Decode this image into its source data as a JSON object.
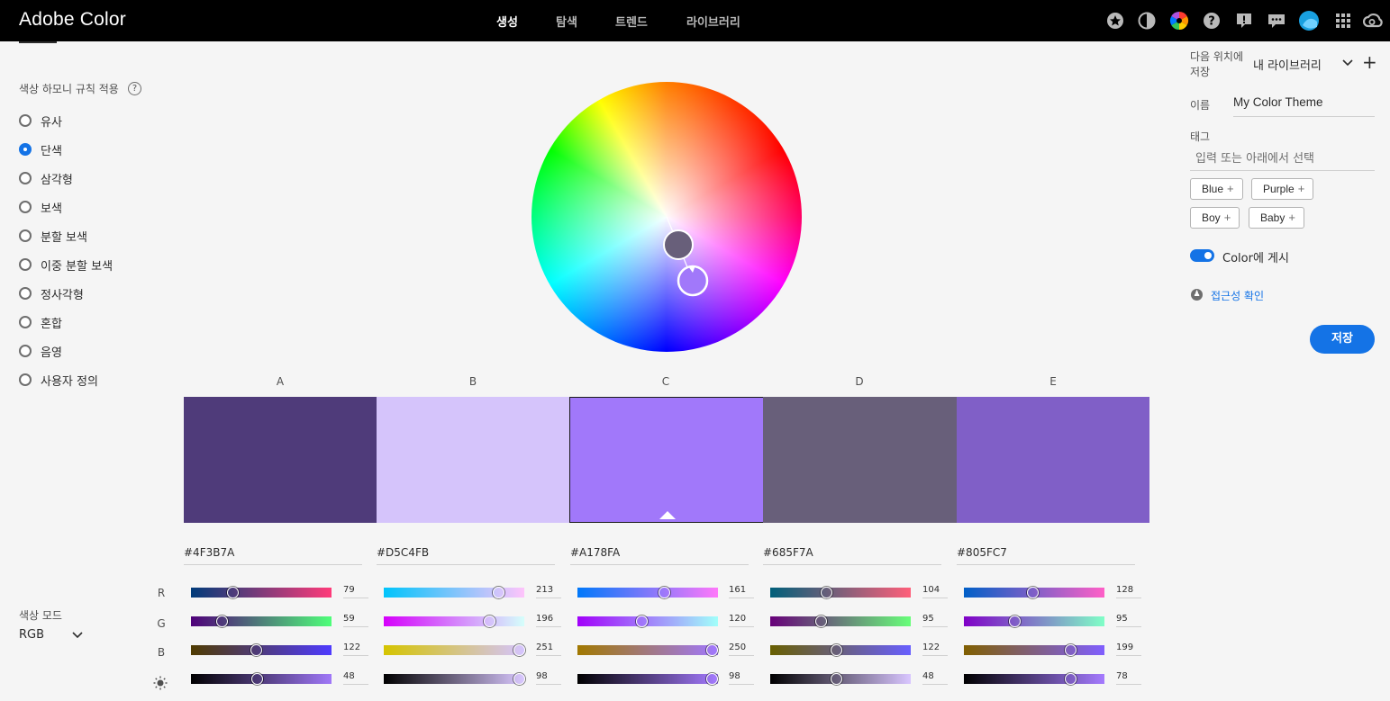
{
  "app": {
    "title": "Adobe Color"
  },
  "nav": [
    {
      "label": "생성",
      "active": true
    },
    {
      "label": "탐색",
      "active": false
    },
    {
      "label": "트렌드",
      "active": false
    },
    {
      "label": "라이브러리",
      "active": false
    }
  ],
  "toolbar_icons": [
    "star-icon",
    "contrast-icon",
    "color-wheel-icon",
    "help-icon",
    "feedback-icon",
    "chat-icon",
    "avatar",
    "apps-grid-icon",
    "creative-cloud-icon"
  ],
  "harmony": {
    "label": "색상 하모니 규칙 적용",
    "rules": [
      {
        "label": "유사",
        "selected": false
      },
      {
        "label": "단색",
        "selected": true
      },
      {
        "label": "삼각형",
        "selected": false
      },
      {
        "label": "보색",
        "selected": false
      },
      {
        "label": "분할 보색",
        "selected": false
      },
      {
        "label": "이중 분할 보색",
        "selected": false
      },
      {
        "label": "정사각형",
        "selected": false
      },
      {
        "label": "혼합",
        "selected": false
      },
      {
        "label": "음영",
        "selected": false
      },
      {
        "label": "사용자 정의",
        "selected": false
      }
    ]
  },
  "color_mode": {
    "label": "색상 모드",
    "value": "RGB"
  },
  "row_labels": [
    "R",
    "G",
    "B"
  ],
  "swatches": [
    {
      "letter": "A",
      "hex": "#4F3B7A",
      "color": "#4F3B7A",
      "selected": false,
      "r": "79",
      "g": "59",
      "b": "122",
      "br": "48"
    },
    {
      "letter": "B",
      "hex": "#D5C4FB",
      "color": "#D5C4FB",
      "selected": false,
      "r": "213",
      "g": "196",
      "b": "251",
      "br": "98"
    },
    {
      "letter": "C",
      "hex": "#A178FA",
      "color": "#A178FA",
      "selected": true,
      "r": "161",
      "g": "120",
      "b": "250",
      "br": "98"
    },
    {
      "letter": "D",
      "hex": "#685F7A",
      "color": "#685F7A",
      "selected": false,
      "r": "104",
      "g": "95",
      "b": "122",
      "br": "48"
    },
    {
      "letter": "E",
      "hex": "#805FC7",
      "color": "#805FC7",
      "selected": false,
      "r": "128",
      "g": "95",
      "b": "199",
      "br": "78"
    }
  ],
  "right_panel": {
    "save_to_label": "다음 위치에 저장",
    "library": "내 라이브러리",
    "name_label": "이름",
    "name_value": "My Color Theme",
    "tags_label": "태그",
    "tags_placeholder": "입력 또는 아래에서 선택",
    "tags": [
      "Blue",
      "Purple",
      "Boy",
      "Baby"
    ],
    "publish_label": "Color에 게시",
    "publish_on": true,
    "accessibility_link": "접근성 확인",
    "save_button": "저장"
  }
}
